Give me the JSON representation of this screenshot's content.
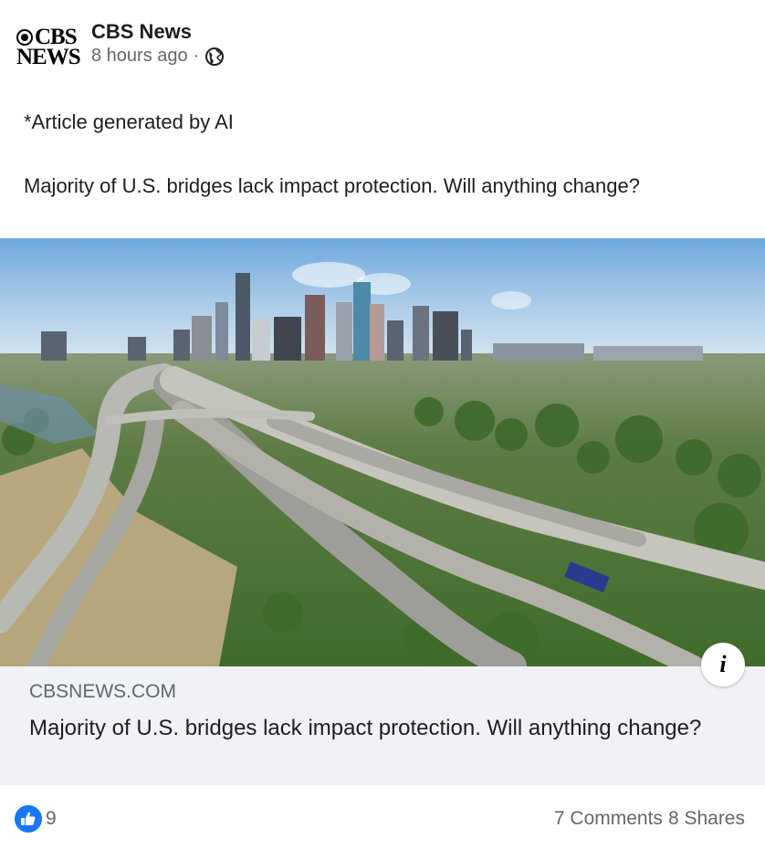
{
  "post": {
    "page_name": "CBS News",
    "logo_text_top": "CBS",
    "logo_text_bottom": "NEWS",
    "timestamp": "8 hours ago",
    "separator": "·",
    "audience_icon": "globe-icon",
    "ai_note": "*Article generated by AI",
    "body": "Majority of U.S. bridges lack impact protection. Will anything change?"
  },
  "link_preview": {
    "image_alt": "Aerial view of Houston highway interchange with downtown skyline",
    "domain": "CBSNEWS.COM",
    "title": "Majority of U.S. bridges lack impact protection. Will anything change?",
    "info_icon": "info-icon",
    "info_label": "i"
  },
  "engagement": {
    "like_icon": "thumbs-up-icon",
    "reactions_count": "9",
    "comments": "7 Comments",
    "shares": "8 Shares"
  },
  "colors": {
    "brand_blue": "#1877f2",
    "card_bg": "#f0f2f5",
    "secondary_text": "#65676b"
  }
}
